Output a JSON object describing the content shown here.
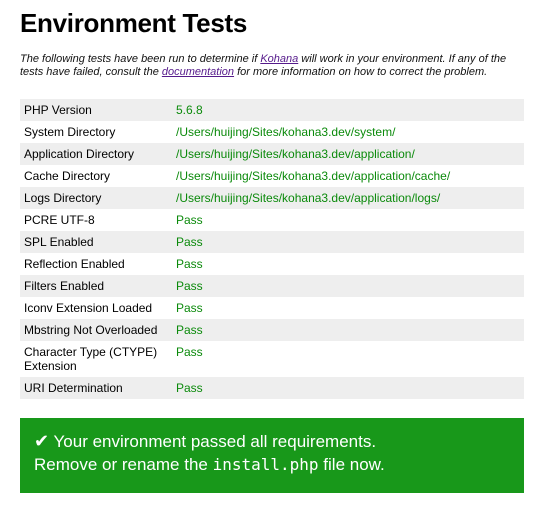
{
  "title": "Environment Tests",
  "intro": {
    "text_1": "The following tests have been run to determine if ",
    "link_kohana": "Kohana",
    "text_2": " will work in your environment. If any of the tests have failed, consult the ",
    "link_documentation": "documentation",
    "text_3": " for more information on how to correct the problem."
  },
  "tests": [
    {
      "name": "PHP Version",
      "result": "5.6.8"
    },
    {
      "name": "System Directory",
      "result": "/Users/huijing/Sites/kohana3.dev/system/"
    },
    {
      "name": "Application Directory",
      "result": "/Users/huijing/Sites/kohana3.dev/application/"
    },
    {
      "name": "Cache Directory",
      "result": "/Users/huijing/Sites/kohana3.dev/application/cache/"
    },
    {
      "name": "Logs Directory",
      "result": "/Users/huijing/Sites/kohana3.dev/application/logs/"
    },
    {
      "name": "PCRE UTF-8",
      "result": "Pass"
    },
    {
      "name": "SPL Enabled",
      "result": "Pass"
    },
    {
      "name": "Reflection Enabled",
      "result": "Pass"
    },
    {
      "name": "Filters Enabled",
      "result": "Pass"
    },
    {
      "name": "Iconv Extension Loaded",
      "result": "Pass"
    },
    {
      "name": "Mbstring Not Overloaded",
      "result": "Pass"
    },
    {
      "name": "Character Type (CTYPE) Extension",
      "result": "Pass"
    },
    {
      "name": "URI Determination",
      "result": "Pass"
    }
  ],
  "banner": {
    "check_glyph": "✔",
    "line1": " Your environment passed all requirements.",
    "line2_before": "Remove or rename the ",
    "line2_code": "install.php",
    "line2_after": " file now."
  },
  "colors": {
    "pass_text": "#0b8a0b",
    "banner_bg": "#18981a",
    "row_stripe": "#eeeeee",
    "link": "#551a8b"
  }
}
